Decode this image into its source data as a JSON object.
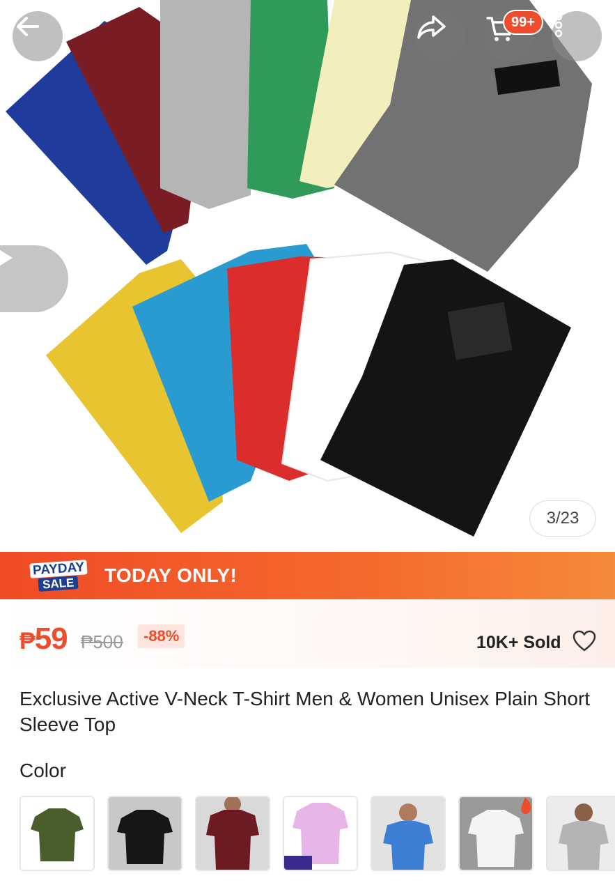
{
  "header": {
    "back_icon": "arrow-left-icon",
    "share_icon": "share-icon",
    "cart_icon": "cart-icon",
    "cart_badge": "99+",
    "more_icon": "more-vertical-icon"
  },
  "gallery": {
    "video_icon": "play-icon",
    "counter": "3/23"
  },
  "sale_banner": {
    "logo_line1": "PAYDAY",
    "logo_line2": "SALE",
    "text": "TODAY ONLY!"
  },
  "price": {
    "currency": "₱",
    "current": "59",
    "original": "₱500",
    "discount": "-88%",
    "sold": "10K+ Sold"
  },
  "product": {
    "title": "Exclusive Active V-Neck T-Shirt Men & Women Unisex Plain Short Sleeve Top"
  },
  "variations": {
    "label": "Color",
    "swatches": [
      {
        "color": "#4a5e2c"
      },
      {
        "color": "#161616"
      },
      {
        "color": "#6e1a22"
      },
      {
        "color": "#e8b5e8"
      },
      {
        "color": "#3d7fd4"
      },
      {
        "color": "#f4f4f4"
      },
      {
        "color": "#b4b4b4"
      }
    ]
  },
  "colors": {
    "accent": "#ee4d2d",
    "payday_blue": "#1c3f94"
  }
}
